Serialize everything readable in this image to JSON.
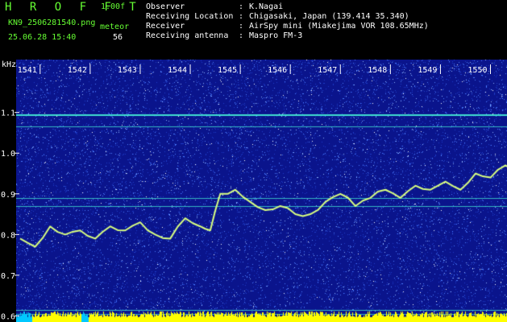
{
  "header": {
    "app_title": "H R O F F T",
    "version": "1.00f",
    "file_name": "KN9_2506281540.png",
    "meteor_label": "meteor",
    "datetime": "25.06.28 15:40",
    "meteor_count": "56",
    "meta": [
      {
        "label": "Observer",
        "value": "K.Nagai"
      },
      {
        "label": "Receiving Location",
        "value": "Chigasaki, Japan (139.414 35.340)"
      },
      {
        "label": "Receiver",
        "value": "AirSpy mini (Miakejima VOR 108.65MHz)"
      },
      {
        "label": "Receiving antenna",
        "value": "Maspro FM-3"
      }
    ]
  },
  "chart_data": {
    "type": "heatmap",
    "x_ticks": [
      "1541",
      "1542",
      "1543",
      "1544",
      "1545",
      "1546",
      "1547",
      "1548",
      "1549",
      "1550"
    ],
    "y_unit": "kHz",
    "y_ticks": [
      "1.1",
      "1.0",
      "0.9",
      "0.8",
      "0.7",
      "0.6"
    ],
    "ylim": [
      0.585,
      1.23
    ],
    "carrier_lines_khz": [
      1.095,
      1.065,
      0.89,
      0.87,
      0.615,
      0.605
    ],
    "trace": {
      "x": [
        1540.6,
        1540.9,
        1541.2,
        1541.5,
        1541.8,
        1542.1,
        1542.4,
        1542.7,
        1543.0,
        1543.3,
        1543.6,
        1543.9,
        1544.2,
        1544.4,
        1544.6,
        1544.9,
        1545.2,
        1545.5,
        1545.8,
        1546.1,
        1546.4,
        1546.7,
        1547.0,
        1547.3,
        1547.6,
        1547.9,
        1548.2,
        1548.5,
        1548.8,
        1549.1,
        1549.4,
        1549.7,
        1550.0,
        1550.3,
        1550.6,
        1550.8
      ],
      "y": [
        0.79,
        0.77,
        0.82,
        0.8,
        0.81,
        0.79,
        0.82,
        0.81,
        0.83,
        0.8,
        0.79,
        0.84,
        0.82,
        0.81,
        0.9,
        0.91,
        0.88,
        0.86,
        0.87,
        0.85,
        0.85,
        0.88,
        0.9,
        0.87,
        0.89,
        0.91,
        0.89,
        0.92,
        0.91,
        0.93,
        0.91,
        0.95,
        0.94,
        0.97,
        0.95,
        0.97
      ]
    },
    "colors": {
      "noise_bg": "#0a148c",
      "noise_dot": "#4a7cff",
      "carrier": "#40e0d0",
      "trace": "#d9ff80",
      "strip": "#ffff00",
      "strip_accent": "#00c8ff",
      "axis_text": "#ffffff"
    }
  }
}
